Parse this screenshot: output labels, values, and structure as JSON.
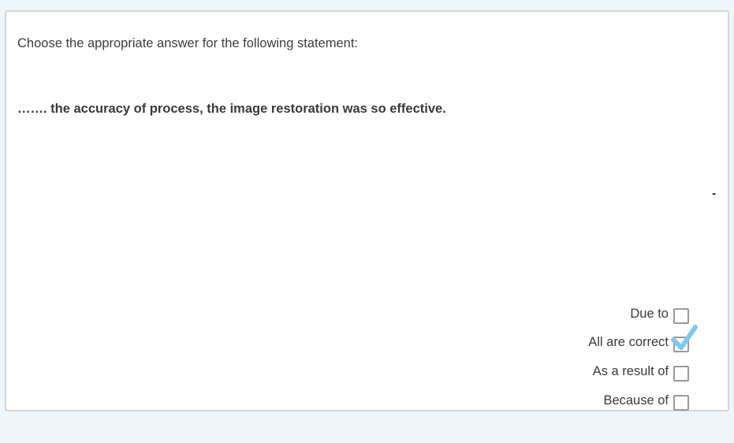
{
  "question": {
    "instruction": "Choose the appropriate answer for the following statement:",
    "statement": "……. the accuracy of process, the image restoration was so effective.",
    "dash": "-"
  },
  "options": [
    {
      "label": "Due to",
      "checked": false
    },
    {
      "label": "All are correct",
      "checked": true
    },
    {
      "label": "As a result of",
      "checked": false
    },
    {
      "label": "Because of",
      "checked": false
    }
  ],
  "colors": {
    "page_background": "#eef6fc",
    "card_background": "#ffffff",
    "check_mark": "#7cc8f0"
  },
  "icons": {
    "check": "check-mark-icon"
  }
}
